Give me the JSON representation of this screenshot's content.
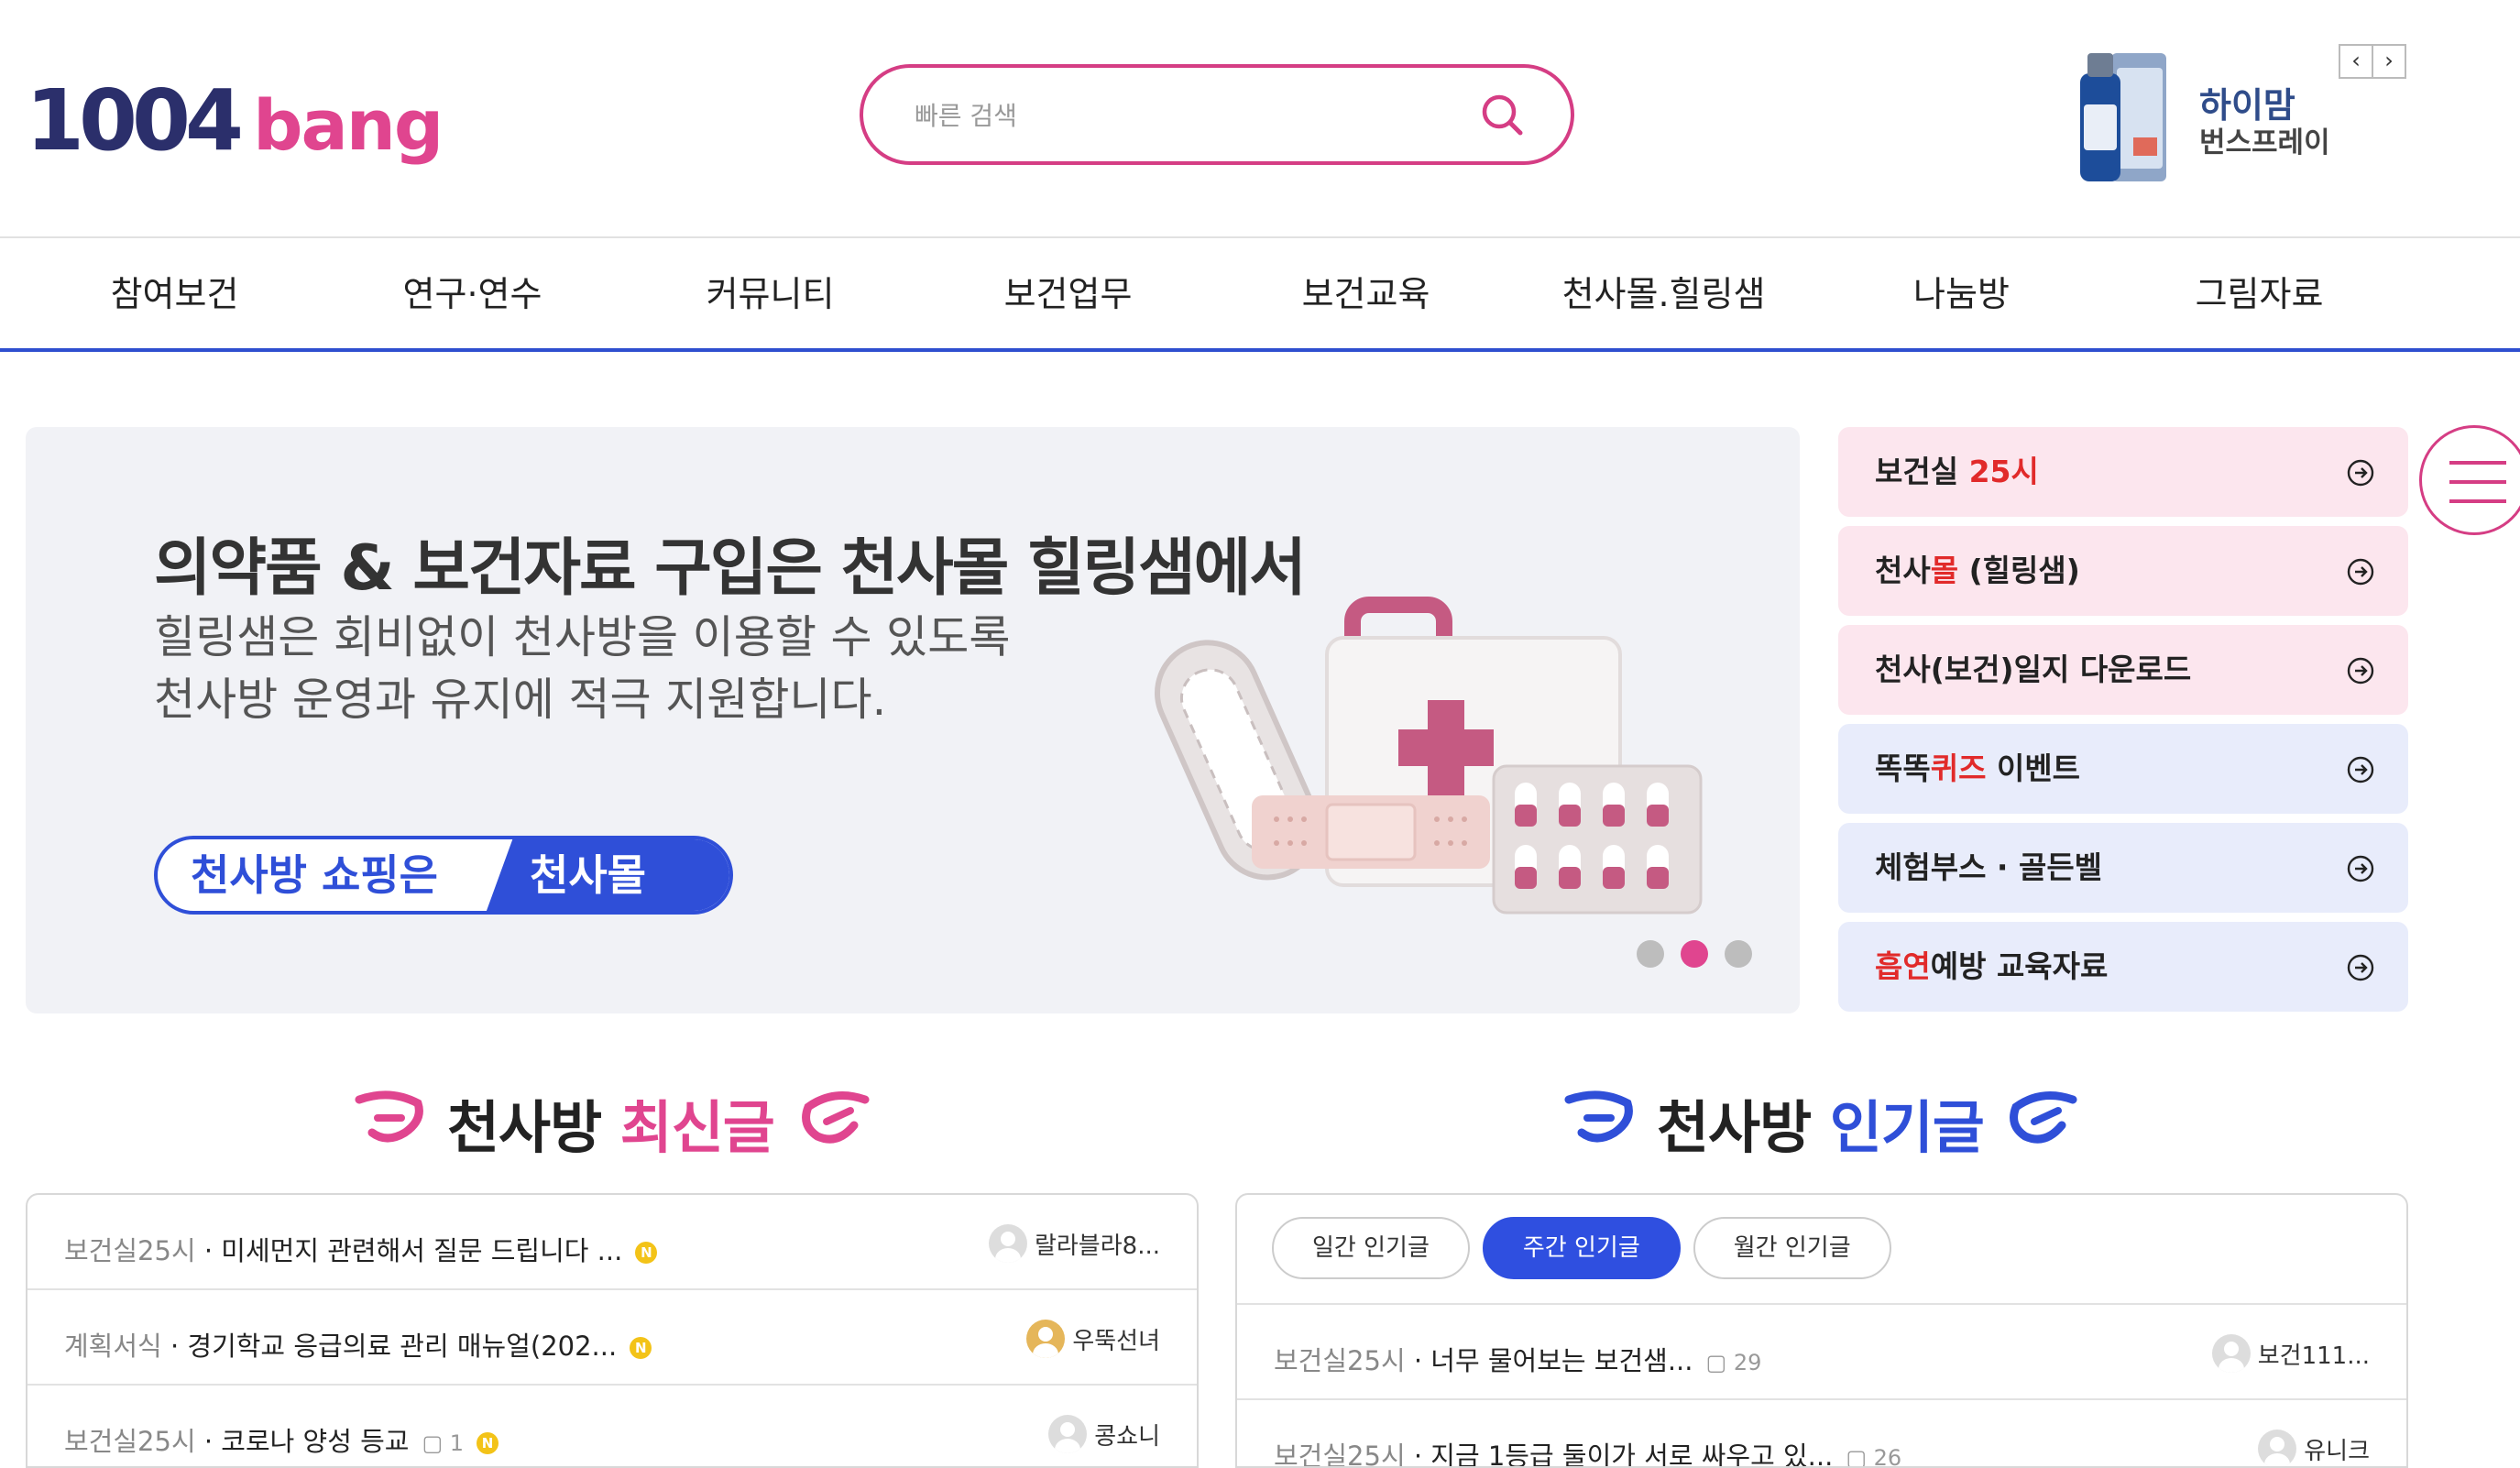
{
  "header": {
    "logo_num": "1004",
    "logo_word": "bang",
    "search_placeholder": "빠른 검색",
    "ad": {
      "line1": "하이맘",
      "line2": "번스프레이"
    },
    "ad_prev": "‹",
    "ad_next": "›"
  },
  "nav": [
    "참여보건",
    "연구·연수",
    "커뮤니티",
    "보건업무",
    "보건교육",
    "천사몰.힐링샘",
    "나눔방",
    "그림자료"
  ],
  "banner": {
    "title": "의약품 & 보건자료 구입은 천사몰 힐링샘에서",
    "line1": "힐링샘은 회비없이 천사방을 이용할 수 있도록",
    "line2": "천사방 운영과 유지에 적극 지원합니다.",
    "pill_left": "천사방 쇼핑은",
    "pill_right": "천사몰",
    "slides_total": 3,
    "slide_active": 2
  },
  "quick_links": [
    {
      "pre": "보건실 ",
      "hl": "25시",
      "post": ""
    },
    {
      "pre": "천사",
      "hl": "몰",
      "post": " (힐링샘)"
    },
    {
      "pre": "천사(보건)일지 다운로드",
      "hl": "",
      "post": ""
    },
    {
      "pre": "똑똑",
      "hl": "퀴즈",
      "post": " 이벤트"
    },
    {
      "pre": "체험부스 · 골든벨",
      "hl": "",
      "post": ""
    },
    {
      "pre": "",
      "hl": "흡연",
      "post": "예방 교육자료"
    }
  ],
  "latest": {
    "title_a": "천사방 ",
    "title_b": "최신글",
    "rows": [
      {
        "cat": "보건실25시",
        "title": " · 미세먼지 관련해서 질문 드립니다 ...",
        "badge": "N",
        "comments": "",
        "author": "랄라블라8..."
      },
      {
        "cat": "계획서식",
        "title": " · 경기학교 응급의료 관리 매뉴얼(202...",
        "badge": "N",
        "comments": "",
        "author": "우뚝선녀"
      },
      {
        "cat": "보건실25시",
        "title": " · 코로나 양성 등교",
        "badge": "N",
        "comments": "1",
        "author": "콩쇼니"
      }
    ]
  },
  "popular": {
    "title_a": "천사방 ",
    "title_b": "인기글",
    "tabs": [
      "일간 인기글",
      "주간 인기글",
      "월간 인기글"
    ],
    "active_tab": 1,
    "rows": [
      {
        "cat": "보건실25시",
        "title": " · 너무 물어보는 보건샘...",
        "comments": "29",
        "author": "보건111..."
      },
      {
        "cat": "보건실25시",
        "title": " · 지금 1등급 둘이가 서로 싸우고 있...",
        "comments": "26",
        "author": "유니크"
      }
    ]
  },
  "colors": {
    "pink": "#e0458f",
    "blue": "#2f4fd8",
    "navy": "#2b2f6b"
  }
}
